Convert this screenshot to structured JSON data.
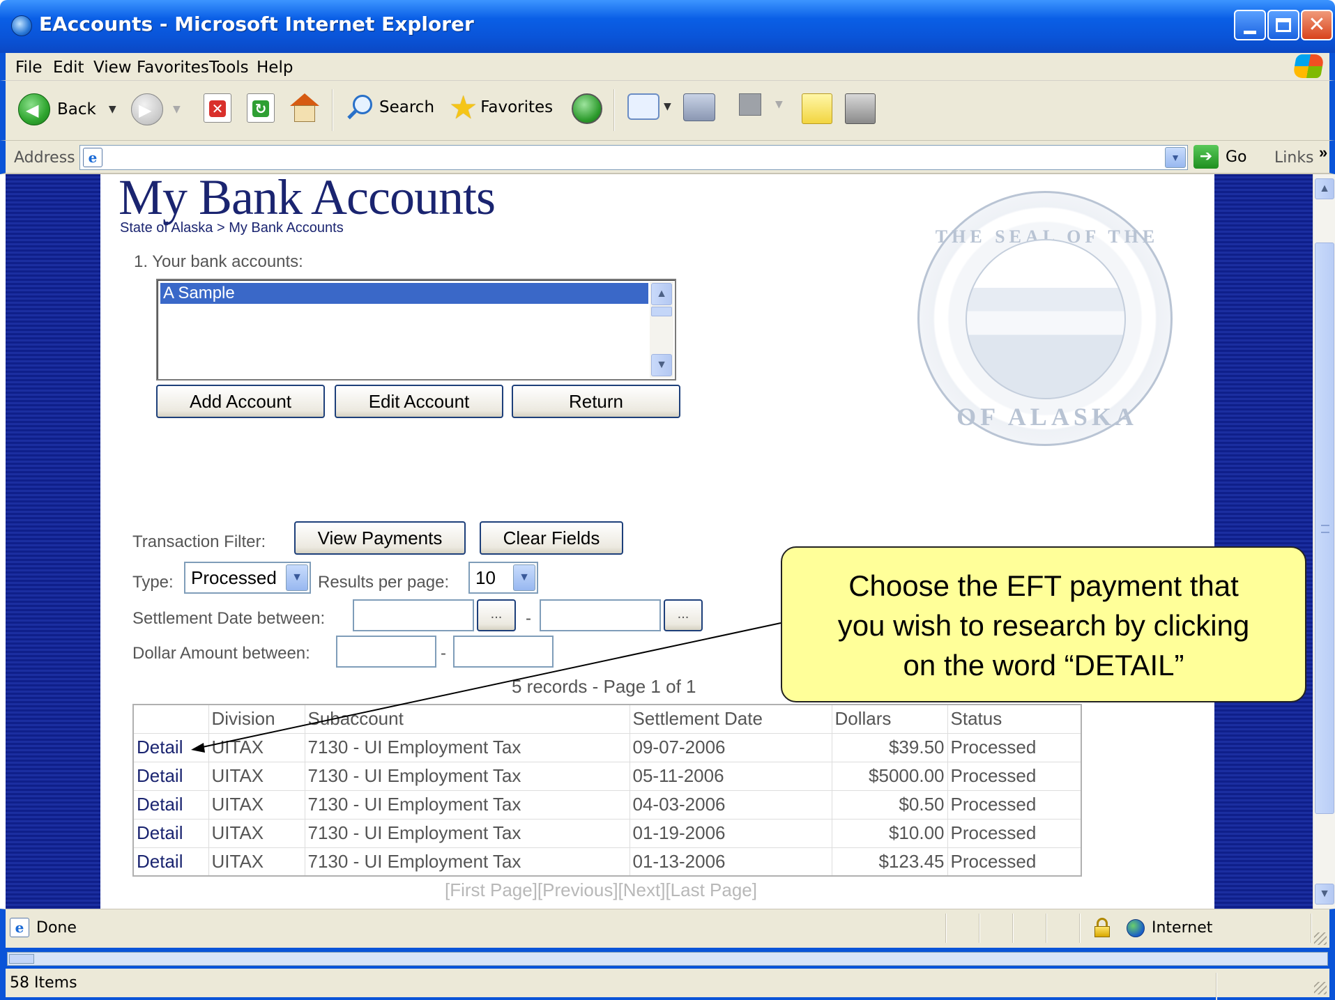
{
  "window": {
    "title": "EAccounts - Microsoft Internet Explorer"
  },
  "menu": [
    "File",
    "Edit",
    "View",
    "Favorites",
    "Tools",
    "Help"
  ],
  "toolbar": {
    "back_label": "Back",
    "search_label": "Search",
    "favorites_label": "Favorites"
  },
  "address": {
    "label": "Address",
    "value": "",
    "go_label": "Go",
    "links_label": "Links",
    "links_chevron": "»"
  },
  "page": {
    "title": "My Bank Accounts",
    "breadcrumb": "State of Alaska > My Bank Accounts",
    "seal_top": "THE SEAL OF THE STATE",
    "seal_bottom": "OF ALASKA",
    "accounts_label": "1. Your bank accounts:",
    "accounts": [
      "A Sample"
    ],
    "buttons": {
      "add": "Add Account",
      "edit": "Edit Account",
      "return": "Return"
    },
    "filter": {
      "label": "Transaction Filter:",
      "view_payments": "View Payments",
      "clear_fields": "Clear Fields",
      "type_label": "Type:",
      "type_value": "Processed",
      "results_label": "Results per page:",
      "results_value": "10",
      "settlement_label": "Settlement Date between:",
      "dollar_label": "Dollar Amount between:",
      "ellipsis": "...",
      "dash": "-"
    },
    "records_text": "5 records - Page 1 of 1",
    "table": {
      "headers": [
        "",
        "Division",
        "Subaccount",
        "Settlement Date",
        "Dollars",
        "Status"
      ],
      "rows": [
        {
          "link": "Detail",
          "division": "UITAX",
          "subaccount": "7130 - UI Employment Tax",
          "date": "09-07-2006",
          "dollars": "$39.50",
          "status": "Processed"
        },
        {
          "link": "Detail",
          "division": "UITAX",
          "subaccount": "7130 - UI Employment Tax",
          "date": "05-11-2006",
          "dollars": "$5000.00",
          "status": "Processed"
        },
        {
          "link": "Detail",
          "division": "UITAX",
          "subaccount": "7130 - UI Employment Tax",
          "date": "04-03-2006",
          "dollars": "$0.50",
          "status": "Processed"
        },
        {
          "link": "Detail",
          "division": "UITAX",
          "subaccount": "7130 - UI Employment Tax",
          "date": "01-19-2006",
          "dollars": "$10.00",
          "status": "Processed"
        },
        {
          "link": "Detail",
          "division": "UITAX",
          "subaccount": "7130 - UI Employment Tax",
          "date": "01-13-2006",
          "dollars": "$123.45",
          "status": "Processed"
        }
      ]
    },
    "pager": "[First Page][Previous][Next][Last Page]"
  },
  "callout": {
    "line1": "Choose the EFT payment that",
    "line2": "you wish to research by clicking",
    "line3": "on the word “DETAIL”"
  },
  "status": {
    "text": "Done",
    "zone": "Internet",
    "items": "58 Items"
  }
}
